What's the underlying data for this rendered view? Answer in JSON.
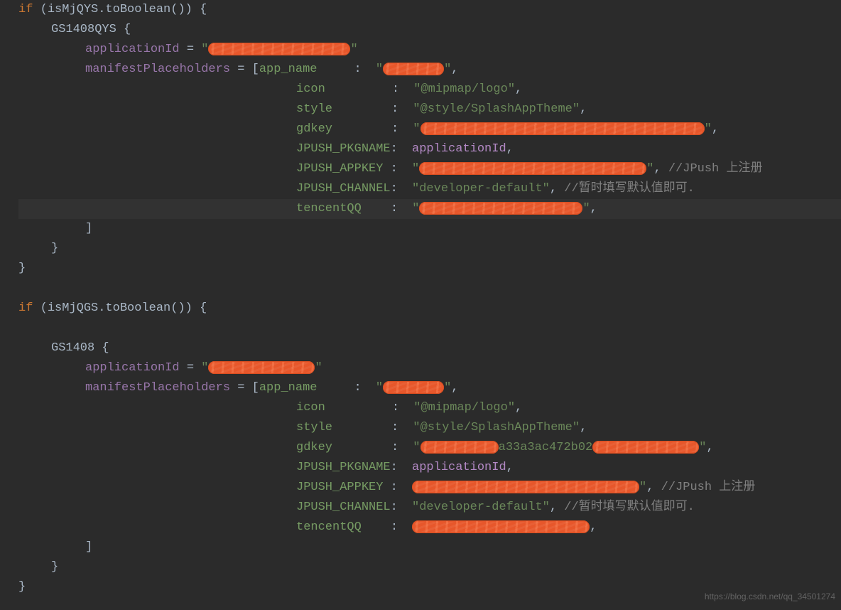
{
  "block1": {
    "if_kw": "if",
    "cond_var": "isMjQYS",
    "cond_call": ".toBoolean()",
    "obj_name": "GS1408QYS",
    "appId_key": "applicationId",
    "appId_op": " = ",
    "appId_q1": "\"",
    "appId_q2": "\"",
    "mph_key": "manifestPlaceholders",
    "mph_op": " = [",
    "rows": {
      "app_name": {
        "k": "app_name",
        "c": ": ",
        "q1": "\"",
        "q2": "\"",
        "tail": ","
      },
      "icon": {
        "k": "icon",
        "c": ": ",
        "v": "\"@mipmap/logo\"",
        "tail": ","
      },
      "style": {
        "k": "style",
        "c": ": ",
        "v": "\"@style/SplashAppTheme\"",
        "tail": ","
      },
      "gdkey": {
        "k": "gdkey",
        "c": ": ",
        "q1": "\"",
        "q2": "\"",
        "tail": ","
      },
      "pkg": {
        "k": "JPUSH_PKGNAME",
        "c": ": ",
        "v": "applicationId",
        "tail": ","
      },
      "appkey": {
        "k": "JPUSH_APPKEY",
        "c": " : ",
        "q1": "\"",
        "q2": "\"",
        "tail": ", ",
        "cmt": "//JPush  上注册"
      },
      "channel": {
        "k": "JPUSH_CHANNEL",
        "c": ": ",
        "v": "\"developer-default\"",
        "tail": ", ",
        "cmt": "//暂时填写默认值即可."
      },
      "qq": {
        "k": "tencentQQ",
        "c": ": ",
        "q1": "\"",
        "q2": "\"",
        "tail": ","
      }
    },
    "close_br": "]",
    "close_bc1": "}",
    "close_bc2": "}"
  },
  "block2": {
    "if_kw": "if",
    "cond_var": "isMjQGS",
    "cond_call": ".toBoolean()",
    "obj_name": "GS1408",
    "appId_key": "applicationId",
    "appId_op": " = ",
    "appId_q1": "\"",
    "appId_q2": "\"",
    "mph_key": "manifestPlaceholders",
    "mph_op": " = [",
    "rows": {
      "app_name": {
        "k": "app_name",
        "c": ": ",
        "q1": "\"",
        "q2": "\"",
        "tail": ","
      },
      "icon": {
        "k": "icon",
        "c": ": ",
        "v": "\"@mipmap/logo\"",
        "tail": ","
      },
      "style": {
        "k": "style",
        "c": ": ",
        "v": "\"@style/SplashAppTheme\"",
        "tail": ","
      },
      "gdkey": {
        "k": "gdkey",
        "c": ": ",
        "q1": "\"",
        "mid": "a33a3ac472b02",
        "q2": "\"",
        "tail": ","
      },
      "pkg": {
        "k": "JPUSH_PKGNAME",
        "c": ": ",
        "v": "applicationId",
        "tail": ","
      },
      "appkey": {
        "k": "JPUSH_APPKEY",
        "c": " : ",
        "q1": "",
        "q2": "\"",
        "tail": ", ",
        "cmt": "//JPush  上注册"
      },
      "channel": {
        "k": "JPUSH_CHANNEL",
        "c": ": ",
        "v": "\"developer-default\"",
        "tail": ", ",
        "cmt": "//暂时填写默认值即可."
      },
      "qq": {
        "k": "tencentQQ",
        "c": ": ",
        "q1": "",
        "q2": "",
        "tail": ","
      }
    },
    "close_br": "]",
    "close_bc1": "}",
    "close_bc2": "}"
  },
  "watermark": "https://blog.csdn.net/qq_34501274"
}
